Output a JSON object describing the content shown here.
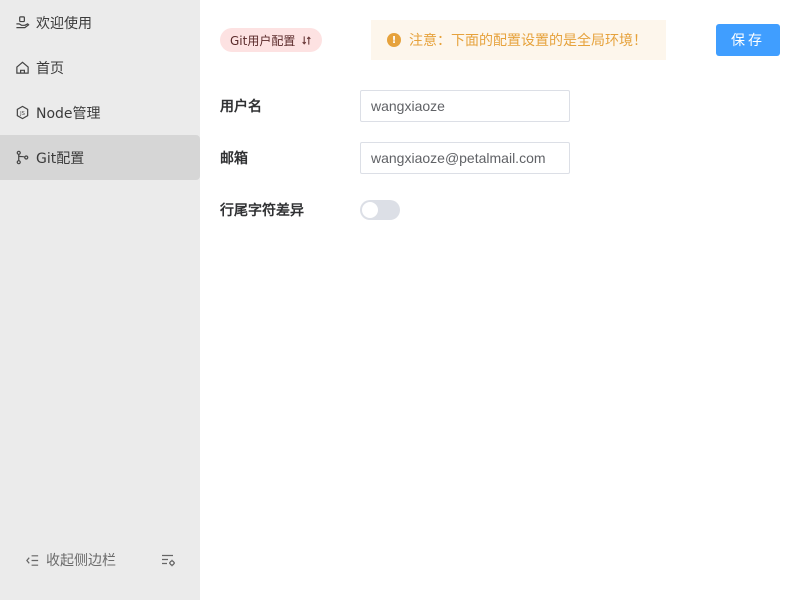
{
  "sidebar": {
    "items": [
      {
        "label": "欢迎使用",
        "icon": "hand-icon",
        "active": false
      },
      {
        "label": "首页",
        "icon": "home-icon",
        "active": false
      },
      {
        "label": "Node管理",
        "icon": "nodejs-icon",
        "active": false
      },
      {
        "label": "Git配置",
        "icon": "git-branch-icon",
        "active": true
      }
    ],
    "collapse_label": "收起侧边栏",
    "collapse_icon": "collapse-icon",
    "settings_icon": "settings-icon"
  },
  "header": {
    "tag_label": "Git用户配置",
    "tag_icon": "swap-icon",
    "alert_text": "注意：下面的配置设置的是全局环境！",
    "alert_icon": "warning-icon",
    "save_label": "保存"
  },
  "form": {
    "username_label": "用户名",
    "username_value": "wangxiaoze",
    "email_label": "邮箱",
    "email_value": "wangxiaoze@petalmail.com",
    "eol_label": "行尾字符差异",
    "eol_enabled": false
  },
  "colors": {
    "sidebar_bg": "#ebebeb",
    "active_item_bg": "#d6d6d6",
    "primary": "#409eff",
    "warning": "#e6a23c",
    "tag_bg": "#fde2e2"
  }
}
